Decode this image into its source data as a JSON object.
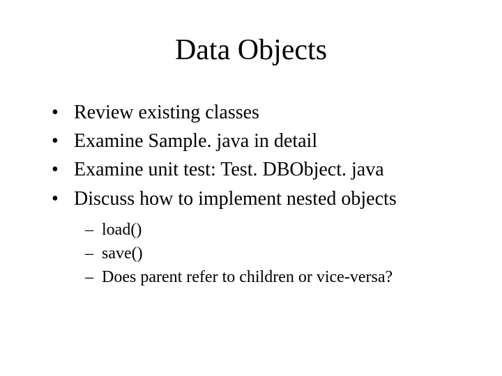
{
  "title": "Data Objects",
  "bullets": [
    {
      "text": "Review existing classes"
    },
    {
      "text": "Examine Sample. java in detail"
    },
    {
      "text": "Examine unit test: Test. DBObject. java"
    },
    {
      "text": "Discuss how to implement nested objects"
    }
  ],
  "subbullets": [
    {
      "text": "load()"
    },
    {
      "text": "save()"
    },
    {
      "text": "Does parent refer to children or vice-versa?"
    }
  ],
  "markers": {
    "bullet": "•",
    "sub": "–"
  }
}
